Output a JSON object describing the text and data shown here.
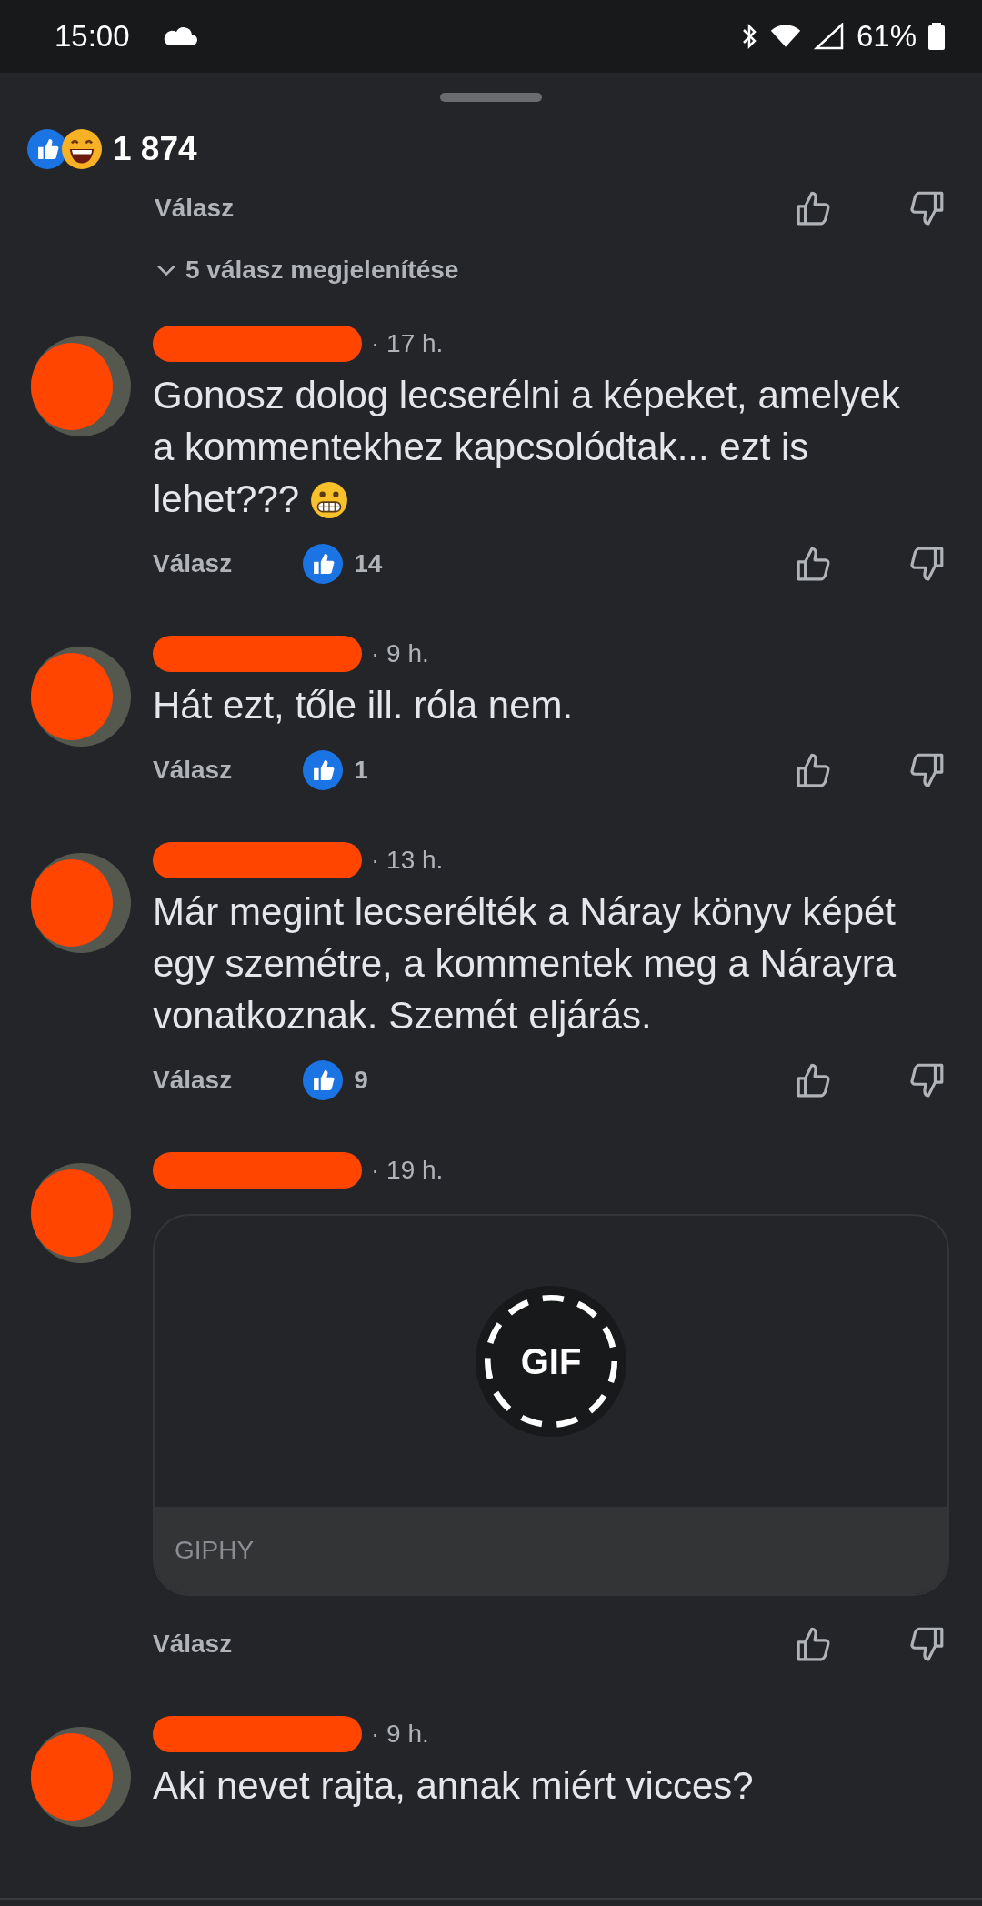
{
  "status_bar": {
    "time": "15:00",
    "battery": "61%"
  },
  "top_reactions": {
    "count": "1 874"
  },
  "top_actions": {
    "reply": "Válasz"
  },
  "show_replies": {
    "label": "5 válasz megjelenítése"
  },
  "comments": [
    {
      "kind": "text",
      "time": "· 17 h.",
      "text": "Gonosz dolog lecserélni a képeket, amelyek a kommentekhez kapcsolódtak... ezt is lehet???",
      "emoji": true,
      "reply": "Válasz",
      "likes": "14"
    },
    {
      "kind": "text",
      "time": "· 9 h.",
      "text": "Hát ezt, tőle ill. róla nem.",
      "reply": "Válasz",
      "likes": "1"
    },
    {
      "kind": "text",
      "time": "· 13 h.",
      "text": "Már megint lecserélték a Náray könyv képét egy szemétre, a kommentek meg a Nárayra vonatkoznak. Szemét eljárás.",
      "reply": "Válasz",
      "likes": "9"
    },
    {
      "kind": "gif",
      "time": "· 19 h.",
      "gif": {
        "badge": "GIF",
        "source": "GIPHY"
      },
      "reply": "Válasz"
    },
    {
      "kind": "text",
      "time": "· 9 h.",
      "text": "Aki nevet rajta, annak miért vicces?"
    }
  ]
}
